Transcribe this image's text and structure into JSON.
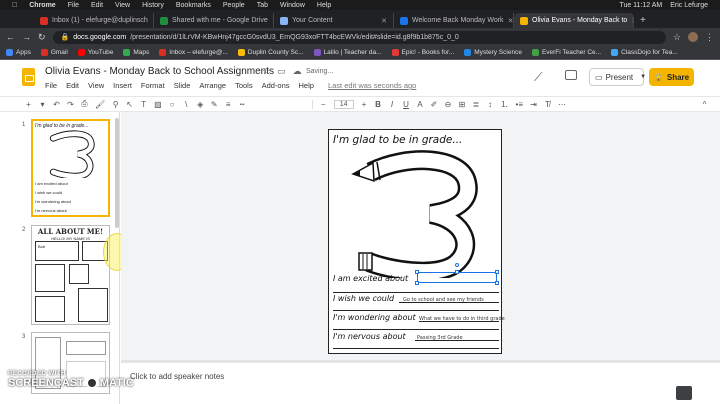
{
  "mac_menu": [
    "Chrome",
    "File",
    "Edit",
    "View",
    "History",
    "Bookmarks",
    "People",
    "Tab",
    "Window",
    "Help"
  ],
  "mac_status": {
    "clock": "Tue 11:12 AM",
    "user": "Eric Lefurge"
  },
  "tabs": [
    {
      "label": "Inbox (1) - elefurge@duplinsch",
      "color": "#d93025"
    },
    {
      "label": "Shared with me - Google Drive",
      "color": "#1e8e3e"
    },
    {
      "label": "Your Content",
      "color": "#8ab4f8"
    },
    {
      "label": "Welcome Back Monday Work",
      "color": "#1a73e8"
    },
    {
      "label": "Olivia Evans - Monday Back to",
      "color": "#f4b400",
      "active": true
    }
  ],
  "address": {
    "domain": "docs.google.com",
    "path": "/presentation/d/1lLrVM-KBwHnj47gccG0svdU3_EmQG93xoFTT4bcEWVk/edit#slide=id.g8f9b1b875c_0_0"
  },
  "bookmarks": [
    {
      "label": "Apps",
      "color": "#4285f4"
    },
    {
      "label": "Gmail",
      "color": "#d93025"
    },
    {
      "label": "YouTube",
      "color": "#ff0000"
    },
    {
      "label": "Maps",
      "color": "#34a853"
    },
    {
      "label": "Inbox – elefurge@...",
      "color": "#d93025"
    },
    {
      "label": "Duplin County Sc...",
      "color": "#fbbc04"
    },
    {
      "label": "Lalilo | Teacher da...",
      "color": "#7e57c2"
    },
    {
      "label": "Epic! - Books for...",
      "color": "#e53935"
    },
    {
      "label": "Mystery Science",
      "color": "#1e88e5"
    },
    {
      "label": "EverFi Teacher Ce...",
      "color": "#43a047"
    },
    {
      "label": "ClassDojo for Tea...",
      "color": "#42a5f5"
    }
  ],
  "doc": {
    "title": "Olivia Evans - Monday Back to School Assignments",
    "saving": "Saving...",
    "menu": [
      "File",
      "Edit",
      "View",
      "Insert",
      "Format",
      "Slide",
      "Arrange",
      "Tools",
      "Add-ons",
      "Help"
    ],
    "last_edit": "Last edit was seconds ago",
    "present_label": "Present",
    "share_label": "Share"
  },
  "toolbar": {
    "font_size": "14"
  },
  "filmstrip": {
    "numbers": [
      "1",
      "2",
      "3"
    ],
    "thumb1": {
      "title": "I'm glad to be in grade...",
      "lines": [
        "I am excited about",
        "I wish we could",
        "I'm wondering about",
        "I'm nervous about"
      ]
    },
    "thumb2": {
      "title": "ALL ABOUT ME!",
      "subtitle": "HELLO! MY NAME IS",
      "name": "Bob"
    }
  },
  "slide": {
    "title": "I'm glad to be in grade...",
    "prompts": [
      {
        "label": "I am excited about",
        "answer": ""
      },
      {
        "label": "I wish we could",
        "answer": "Go to school and see my friends"
      },
      {
        "label": "I'm wondering about",
        "answer": "What we have to do in third grade"
      },
      {
        "label": "I'm nervous about",
        "answer": "Passing 3rd Grade"
      }
    ]
  },
  "notes": {
    "placeholder": "Click to add speaker notes"
  },
  "watermark": {
    "line1": "RECORDED WITH",
    "line2a": "SCREENCAST",
    "line2b": "MATIC"
  }
}
